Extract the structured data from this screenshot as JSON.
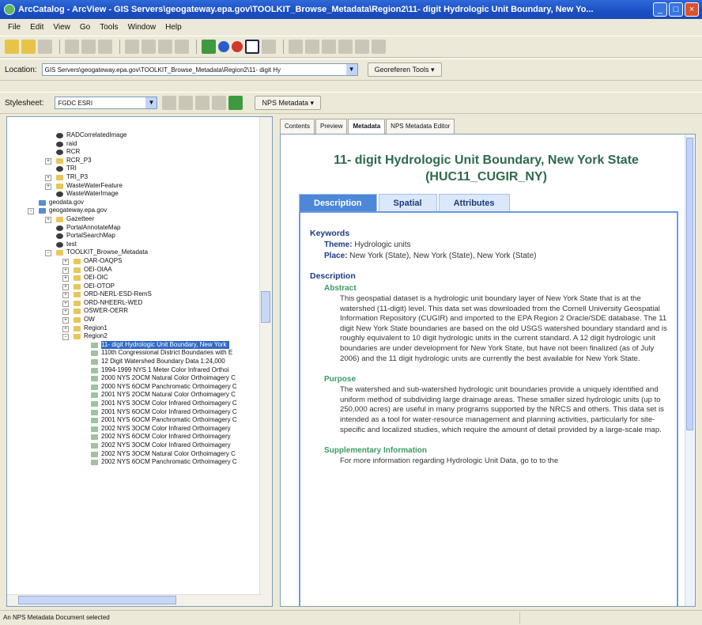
{
  "window": {
    "title": "ArcCatalog - ArcView - GIS Servers\\geogateway.epa.gov\\TOOLKIT_Browse_Metadata\\Region2\\11- digit Hydrologic Unit Boundary, New Yo...",
    "min_glyph": "_",
    "max_glyph": "□",
    "close_glyph": "×"
  },
  "menu": [
    "File",
    "Edit",
    "View",
    "Go",
    "Tools",
    "Window",
    "Help"
  ],
  "location": {
    "label": "Location:",
    "value": "GIS Servers\\geogateway.epa.gov\\TOOLKIT_Browse_Metadata\\Region2\\11- digit Hy",
    "tools_button": "Georeferen Tools ▾"
  },
  "stylesheet": {
    "label": "Stylesheet:",
    "value": "FGDC ESRI",
    "metadata_button": "NPS Metadata ▾"
  },
  "tree": [
    {
      "label": "RADCorrelatedImage",
      "indent": 62,
      "icon": "layer"
    },
    {
      "label": "raid",
      "indent": 62,
      "icon": "layer"
    },
    {
      "label": "RCR",
      "indent": 62,
      "icon": "layer"
    },
    {
      "label": "RCR_P3",
      "indent": 62,
      "icon": "folder",
      "exp": "+"
    },
    {
      "label": "TRI",
      "indent": 62,
      "icon": "layer"
    },
    {
      "label": "TRI_P3",
      "indent": 62,
      "icon": "folder",
      "exp": "+"
    },
    {
      "label": "WasteWaterFeature",
      "indent": 62,
      "icon": "folder",
      "exp": "+"
    },
    {
      "label": "WasteWaterImage",
      "indent": 62,
      "icon": "layer"
    },
    {
      "label": "geodata.gov",
      "indent": 40,
      "icon": "globe"
    },
    {
      "label": "geogateway.epa.gov",
      "indent": 40,
      "icon": "globe",
      "exp": "−"
    },
    {
      "label": "Gazetteer",
      "indent": 62,
      "icon": "folder",
      "exp": "+"
    },
    {
      "label": "PortalAnnotateMap",
      "indent": 62,
      "icon": "layer"
    },
    {
      "label": "PortalSearchMap",
      "indent": 62,
      "icon": "layer"
    },
    {
      "label": "test",
      "indent": 62,
      "icon": "layer"
    },
    {
      "label": "TOOLKIT_Browse_Metadata",
      "indent": 62,
      "icon": "folder",
      "exp": "−"
    },
    {
      "label": "OAR-OAQPS",
      "indent": 84,
      "icon": "folder",
      "exp": "+"
    },
    {
      "label": "OEI-OIAA",
      "indent": 84,
      "icon": "folder",
      "exp": "+"
    },
    {
      "label": "OEI-OIC",
      "indent": 84,
      "icon": "folder",
      "exp": "+"
    },
    {
      "label": "OEI-OTOP",
      "indent": 84,
      "icon": "folder",
      "exp": "+"
    },
    {
      "label": "ORD-NERL-ESD-RemS",
      "indent": 84,
      "icon": "folder",
      "exp": "+"
    },
    {
      "label": "ORD-NHEERL-WED",
      "indent": 84,
      "icon": "folder",
      "exp": "+"
    },
    {
      "label": "OSWER-OERR",
      "indent": 84,
      "icon": "folder",
      "exp": "+"
    },
    {
      "label": "OW",
      "indent": 84,
      "icon": "folder",
      "exp": "+"
    },
    {
      "label": "Region1",
      "indent": 84,
      "icon": "folder",
      "exp": "+"
    },
    {
      "label": "Region2",
      "indent": 84,
      "icon": "folder",
      "exp": "−"
    },
    {
      "label": "11- digit Hydrologic Unit Boundary, New York",
      "indent": 106,
      "icon": "file",
      "sel": true
    },
    {
      "label": "110th Congressional District Boundaries with E",
      "indent": 106,
      "icon": "file"
    },
    {
      "label": "12 Digit Watershed Boundary Data 1:24,000",
      "indent": 106,
      "icon": "file"
    },
    {
      "label": "1994-1999 NYS 1 Meter Color Infrared Orthoi",
      "indent": 106,
      "icon": "file"
    },
    {
      "label": "2000 NYS 2OCM Natural Color Orthoimagery C",
      "indent": 106,
      "icon": "file"
    },
    {
      "label": "2000 NYS 6OCM Panchromatic Orthoimagery C",
      "indent": 106,
      "icon": "file"
    },
    {
      "label": "2001 NYS 2OCM Natural Color Orthoimagery C",
      "indent": 106,
      "icon": "file"
    },
    {
      "label": "2001 NYS 3OCM Color Infrared Orthoimagery C",
      "indent": 106,
      "icon": "file"
    },
    {
      "label": "2001 NYS 6OCM Color Infrared Orthoimagery C",
      "indent": 106,
      "icon": "file"
    },
    {
      "label": "2001 NYS 6OCM Panchromatic Orthoimagery C",
      "indent": 106,
      "icon": "file"
    },
    {
      "label": "2002 NYS 3OCM Color Infrared Orthoimagery",
      "indent": 106,
      "icon": "file"
    },
    {
      "label": "2002 NYS 6OCM Color Infrared Orthoimagery",
      "indent": 106,
      "icon": "file"
    },
    {
      "label": "2002 NYS 3OCM Color Infrared Orthoimagery",
      "indent": 106,
      "icon": "file"
    },
    {
      "label": "2002 NYS 3OCM Natural Color Orthoimagery C",
      "indent": 106,
      "icon": "file"
    },
    {
      "label": "2002 NYS 6OCM Panchromatic Orthoimagery C",
      "indent": 106,
      "icon": "file"
    }
  ],
  "right_tabs": [
    "Contents",
    "Preview",
    "Metadata",
    "NPS Metadata Editor"
  ],
  "metadata": {
    "title": "11- digit Hydrologic Unit Boundary, New York State (HUC11_CUGIR_NY)",
    "tabs": [
      "Description",
      "Spatial",
      "Attributes"
    ],
    "keywords_heading": "Keywords",
    "theme_label": "Theme:",
    "theme_value": "Hydrologic units",
    "place_label": "Place:",
    "place_value": "New York (State), New York (State), New York (State)",
    "description_heading": "Description",
    "abstract_heading": "Abstract",
    "abstract": "This geospatial dataset is a hydrologic unit boundary layer of New York State that is at the watershed (11-digit) level. This data set was downloaded from the Cornell University Geospatial Information Repository (CUGIR) and imported to the EPA Region 2 Oracle/SDE database.  The 11 digit New York State boundaries are based on the old USGS watershed boundary standard and is roughly equivalent to 10 digit hydrologic units in the current standard.  A 12 digit hydrologic unit boundaries are under development for New York State, but have not been finalized (as of July 2006) and the 11 digit hydrologic units are currently the best available for New York State.",
    "purpose_heading": "Purpose",
    "purpose": "The watershed and sub-watershed hydrologic unit boundaries provide a uniquely identified and uniform method of subdividing large drainage areas. These smaller sized hydrologic units (up to 250,000 acres) are useful in many programs supported by the NRCS and others. This data set is intended as a tool for water-resource management and planning activities, particularly for site-specific and localized studies, which require the amount of detail provided by a large-scale map.",
    "supplementary_heading": "Supplementary Information",
    "supplementary": "For more information regarding Hydrologic Unit Data, go to to the"
  },
  "status": "An NPS Metadata Document selected"
}
